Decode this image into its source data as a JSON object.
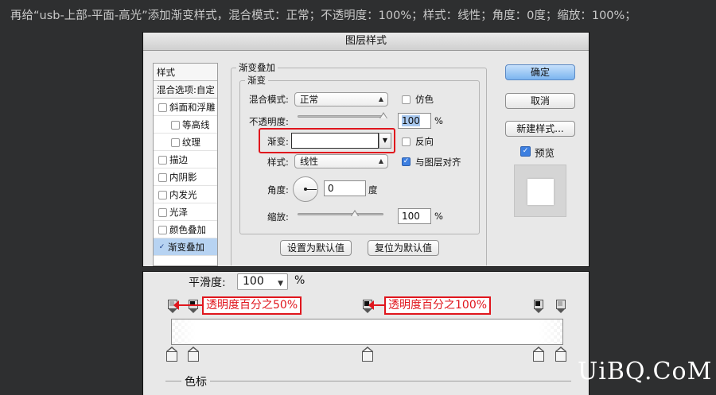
{
  "instruction": "再给“usb-上部-平面-高光”添加渐变样式，混合模式：正常；不透明度：100%；样式：线性；角度：0度；缩放：100%；",
  "dialog": {
    "title": "图层样式",
    "styles_header": "样式",
    "blend_options": "混合选项:自定",
    "style_items": [
      {
        "label": "斜面和浮雕",
        "checked": false
      },
      {
        "label": "等高线",
        "checked": false
      },
      {
        "label": "纹理",
        "checked": false
      },
      {
        "label": "描边",
        "checked": false
      },
      {
        "label": "内阴影",
        "checked": false
      },
      {
        "label": "内发光",
        "checked": false
      },
      {
        "label": "光泽",
        "checked": false
      },
      {
        "label": "颜色叠加",
        "checked": false
      },
      {
        "label": "渐变叠加",
        "checked": true,
        "selected": true
      }
    ],
    "section_title": "渐变叠加",
    "group_title": "渐变",
    "blend_mode_label": "混合模式:",
    "blend_mode_value": "正常",
    "dither_label": "仿色",
    "opacity_label": "不透明度:",
    "opacity_value": "100",
    "opacity_percent": 100,
    "percent_sign": "%",
    "gradient_label": "渐变:",
    "reverse_label": "反向",
    "style_label": "样式:",
    "style_value": "线性",
    "align_label": "与图层对齐",
    "align_checked": true,
    "angle_label": "角度:",
    "angle_value": "0",
    "degree_label": "度",
    "scale_label": "缩放:",
    "scale_value": "100",
    "scale_percent": 100,
    "set_default_button": "设置为默认值",
    "reset_default_button": "复位为默认值",
    "ok_button": "确定",
    "cancel_button": "取消",
    "new_style_button": "新建样式...",
    "preview_label": "预览",
    "preview_checked": true
  },
  "editor": {
    "smoothness_label": "平滑度:",
    "smoothness_value": "100",
    "percent_sign": "%",
    "callout_left": "透明度百分之50%",
    "callout_mid": "透明度百分之100%",
    "color_stop_label": "色标"
  },
  "watermark": "UiBQ.CoM",
  "colors": {
    "accent_red": "#e0161d",
    "primary_button": "#7bb4ef",
    "selection": "#b7d3f2"
  }
}
